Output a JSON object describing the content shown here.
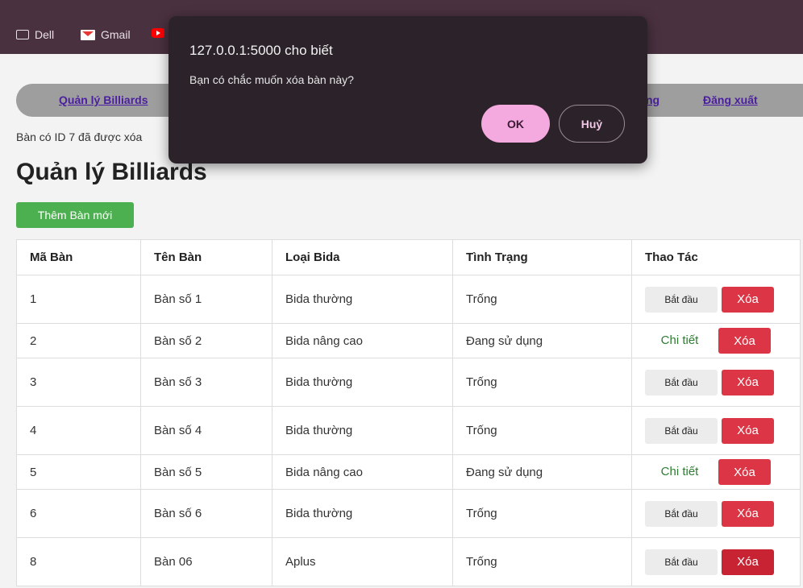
{
  "bookmarks": [
    {
      "label": "Dell",
      "icon": "folder-icon"
    },
    {
      "label": "Gmail",
      "icon": "gmail-icon"
    },
    {
      "label": "",
      "icon": "youtube-icon"
    }
  ],
  "nav": {
    "left_link": "Quản lý Billiards",
    "right_partial": "ng",
    "logout": "Đăng xuất"
  },
  "flash_message": "Bàn có ID 7 đã được xóa",
  "page_title": "Quản lý Billiards",
  "add_button": "Thêm Bàn mới",
  "table": {
    "headers": [
      "Mã Bàn",
      "Tên Bàn",
      "Loại Bida",
      "Tình Trạng",
      "Thao Tác"
    ],
    "rows": [
      {
        "id": "1",
        "name": "Bàn số 1",
        "type": "Bida thường",
        "status": "Trống",
        "action": "Bắt đầu",
        "delete": "Xóa"
      },
      {
        "id": "2",
        "name": "Bàn số 2",
        "type": "Bida nâng cao",
        "status": "Đang sử dụng",
        "action": "Chi tiết",
        "delete": "Xóa"
      },
      {
        "id": "3",
        "name": "Bàn số 3",
        "type": "Bida thường",
        "status": "Trống",
        "action": "Bắt đầu",
        "delete": "Xóa"
      },
      {
        "id": "4",
        "name": "Bàn số 4",
        "type": "Bida thường",
        "status": "Trống",
        "action": "Bắt đầu",
        "delete": "Xóa"
      },
      {
        "id": "5",
        "name": "Bàn số 5",
        "type": "Bida nâng cao",
        "status": "Đang sử dụng",
        "action": "Chi tiết",
        "delete": "Xóa"
      },
      {
        "id": "6",
        "name": "Bàn số 6",
        "type": "Bida thường",
        "status": "Trống",
        "action": "Bắt đầu",
        "delete": "Xóa"
      },
      {
        "id": "8",
        "name": "Bàn 06",
        "type": "Aplus",
        "status": "Trống",
        "action": "Bắt đầu",
        "delete": "Xóa"
      }
    ]
  },
  "dialog": {
    "title": "127.0.0.1:5000 cho biết",
    "message": "Bạn có chắc muốn xóa bàn này?",
    "ok": "OK",
    "cancel": "Huỷ"
  },
  "colors": {
    "bookmark_bar": "#4a3140",
    "nav_bg": "#9e9e9e",
    "nav_link": "#4b1fa0",
    "add_button": "#4caf50",
    "delete_button": "#dc3545",
    "detail_link": "#2e7d32",
    "dialog_bg": "#2b2329",
    "dialog_ok": "#f4a9df"
  }
}
